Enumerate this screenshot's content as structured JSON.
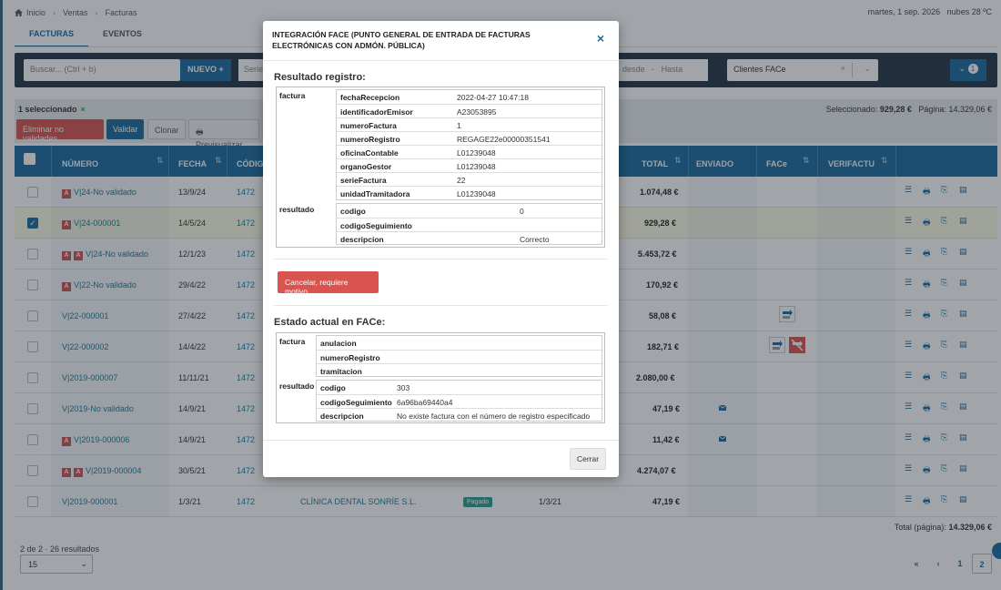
{
  "breadcrumb": {
    "home": "Inicio",
    "ventas": "Ventas",
    "current": "Facturas"
  },
  "datetime": "martes, 1 sep. 2026",
  "weather": "nubes 28 ºC",
  "tabs": [
    {
      "label": "FACTURAS"
    },
    {
      "label": "EVENTOS"
    }
  ],
  "filters": {
    "search_placeholder": "Buscar... (Ctrl + b)",
    "new_label": "NUEVO",
    "serie_placeholder": "Serie",
    "date_from": "desde",
    "date_sep": "-",
    "date_to": "Hasta",
    "clients_value": "Clientes FACe",
    "filter_count": "1"
  },
  "actionbar": {
    "selected_text": "1 seleccionado",
    "delete_label": "Eliminar no validadas",
    "validate_label": "Validar",
    "clone_label": "Clonar",
    "preview_label": "Previsualizar",
    "selected_total_label": "Seleccionado:",
    "selected_total": "929,28 €",
    "page_total_label": "Página:",
    "page_total": "14.329,06 €"
  },
  "table": {
    "headers": {
      "numero": "NÚMERO",
      "fecha": "FECHA",
      "codigo": "CÓDIGO",
      "total": "TOTAL",
      "enviado": "ENVIADO",
      "face": "FACe",
      "verifactu": "VERIFACTU"
    },
    "rows": [
      {
        "badges": "A",
        "numero": "V|24-No validado",
        "fecha": "13/9/24",
        "codigo": "1472",
        "total": "1.074,48 €"
      },
      {
        "badges": "A",
        "numero": "V|24-000001",
        "fecha": "14/5/24",
        "codigo": "1472",
        "total": "929,28 €"
      },
      {
        "badges": "AA",
        "numero": "V|24-No validado",
        "fecha": "12/1/23",
        "codigo": "1472",
        "total": "5.453,72 €"
      },
      {
        "badges": "A",
        "numero": "V|22-No validado",
        "fecha": "29/4/22",
        "codigo": "1472",
        "total": "170,92 €"
      },
      {
        "badges": "",
        "numero": "V|22-000001",
        "fecha": "27/4/22",
        "codigo": "1472",
        "total": "58,08 €"
      },
      {
        "badges": "",
        "numero": "V|22-000002",
        "fecha": "14/4/22",
        "codigo": "1472",
        "total": "182,71 €"
      },
      {
        "badges": "",
        "numero": "V|2019-000007",
        "fecha": "11/11/21",
        "codigo": "1472",
        "total": "2.080,00 €"
      },
      {
        "badges": "",
        "numero": "V|2019-No validado",
        "fecha": "14/9/21",
        "codigo": "1472",
        "total": "47,19 €"
      },
      {
        "badges": "A",
        "numero": "V|2019-000006",
        "fecha": "14/9/21",
        "codigo": "1472",
        "total": "11,42 €"
      },
      {
        "badges": "AA",
        "numero": "V|2019-000004",
        "fecha": "30/5/21",
        "codigo": "1472",
        "total": "4.274,07 €"
      },
      {
        "badges": "",
        "numero": "V|2019-000001",
        "fecha": "1/3/21",
        "codigo": "1472",
        "cliente": "CLÍNICA DENTAL SONRÍE S.L.",
        "estado": "Pagado",
        "fecha2": "1/3/21",
        "total": "47,19 €"
      }
    ],
    "footer_label": "Total (página):",
    "footer_total": "14.329,06 €"
  },
  "pager": {
    "info": "2 de 2 · 26 resultados",
    "page_size": "15",
    "first": "«",
    "prev": "‹",
    "pages": [
      "1",
      "2"
    ]
  },
  "modal": {
    "title": "INTEGRACIÓN FACE (PUNTO GENERAL DE ENTRADA DE FACTURAS ELECTRÓNICAS CON ADMÓN. PÚBLICA)",
    "close_icon": "×",
    "registro_title": "Resultado registro:",
    "registro": {
      "factura_label": "factura",
      "factura": [
        {
          "k": "fechaRecepcion",
          "v": "2022-04-27 10:47:18"
        },
        {
          "k": "identificadorEmisor",
          "v": "A23053895"
        },
        {
          "k": "numeroFactura",
          "v": "1"
        },
        {
          "k": "numeroRegistro",
          "v": "REGAGE22e00000351541"
        },
        {
          "k": "oficinaContable",
          "v": "L01239048"
        },
        {
          "k": "organoGestor",
          "v": "L01239048"
        },
        {
          "k": "serieFactura",
          "v": "22"
        },
        {
          "k": "unidadTramitadora",
          "v": "L01239048"
        }
      ],
      "resultado_label": "resultado",
      "resultado": [
        {
          "k": "codigo",
          "v": "0"
        },
        {
          "k": "codigoSeguimiento",
          "v": ""
        },
        {
          "k": "descripcion",
          "v": "Correcto"
        }
      ]
    },
    "cancel_label": "Cancelar, requiere motivo",
    "estado_title": "Estado actual en FACe:",
    "estado": {
      "factura_label": "factura",
      "factura": [
        {
          "k": "anulacion",
          "v": ""
        },
        {
          "k": "numeroRegistro",
          "v": ""
        },
        {
          "k": "tramitacion",
          "v": ""
        }
      ],
      "resultado_label": "resultado",
      "resultado": [
        {
          "k": "codigo",
          "v": "303"
        },
        {
          "k": "codigoSeguimiento",
          "v": "6a96ba69440a4"
        },
        {
          "k": "descripcion",
          "v": "No existe factura con el número de registro especificado"
        }
      ]
    },
    "cerrar_label": "Cerrar"
  },
  "colors": {
    "primary": "#1a6aa0",
    "danger": "#d9534f",
    "header_dark": "#243245"
  }
}
